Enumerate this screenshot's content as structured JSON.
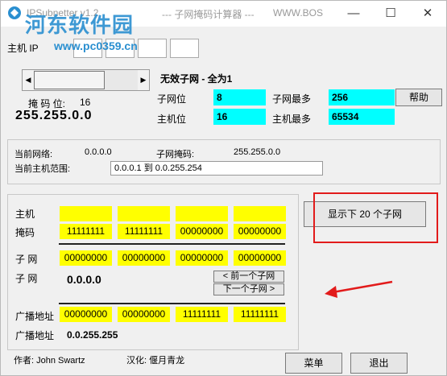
{
  "window": {
    "title": "IPSubnetter v1.2",
    "title_center": "--- 子网掩码计算器 ---",
    "title_right": "WWW.BOS",
    "minimize": "—",
    "maximize": "☐",
    "close": "✕"
  },
  "watermark": {
    "site": "河东软件园",
    "url": "www.pc0359.cn"
  },
  "host_ip": {
    "label": "主机 IP",
    "octets": [
      "",
      "",
      "",
      ""
    ]
  },
  "mask": {
    "subnet_state": "无效子网 - 全为1",
    "mask_bits_label": "掩 码 位:",
    "mask_bits_value": "16",
    "mask_value": "255.255.0.0",
    "slider_position": 0.52
  },
  "stats": {
    "subnet_bits_label": "子网位",
    "subnet_bits_value": "8",
    "max_subnets_label": "子网最多",
    "max_subnets_value": "256",
    "host_bits_label": "主机位",
    "host_bits_value": "16",
    "max_hosts_label": "主机最多",
    "max_hosts_value": "65534",
    "help_button": "帮助"
  },
  "current": {
    "network_label": "当前网络:",
    "network_value": "0.0.0.0",
    "subnet_mask_label": "子网掩码:",
    "subnet_mask_value": "255.255.0.0",
    "host_range_label": "当前主机范围:",
    "host_range_value": "0.0.0.1  到  0.0.255.254"
  },
  "binary": {
    "host_label": "主机",
    "host_cells": [
      "",
      "",
      "",
      ""
    ],
    "mask_label": "掩码",
    "mask_cells": [
      "11111111",
      "11111111",
      "00000000",
      "00000000"
    ],
    "subnet_label": "子  网",
    "subnet_cells": [
      "00000000",
      "00000000",
      "00000000",
      "00000000"
    ],
    "subnet2_label": "子  网",
    "subnet_value": "0.0.0.0",
    "prev_subnet": "< 前一个子网",
    "next_subnet": "下一个子网 >",
    "broadcast_label": "广播地址",
    "broadcast_cells": [
      "00000000",
      "00000000",
      "11111111",
      "11111111"
    ],
    "broadcast2_label": "广播地址",
    "broadcast_value": "0.0.255.255"
  },
  "show_next": {
    "label": "显示下 20 个子网"
  },
  "footer": {
    "author": "作者: John Swartz",
    "localized": "汉化: 偃月青龙",
    "menu_button": "菜单",
    "exit_button": "退出"
  },
  "colors": {
    "accent_cyan": "#00ffff",
    "yellow": "#ffff00",
    "highlight_red": "#e21b1b"
  }
}
